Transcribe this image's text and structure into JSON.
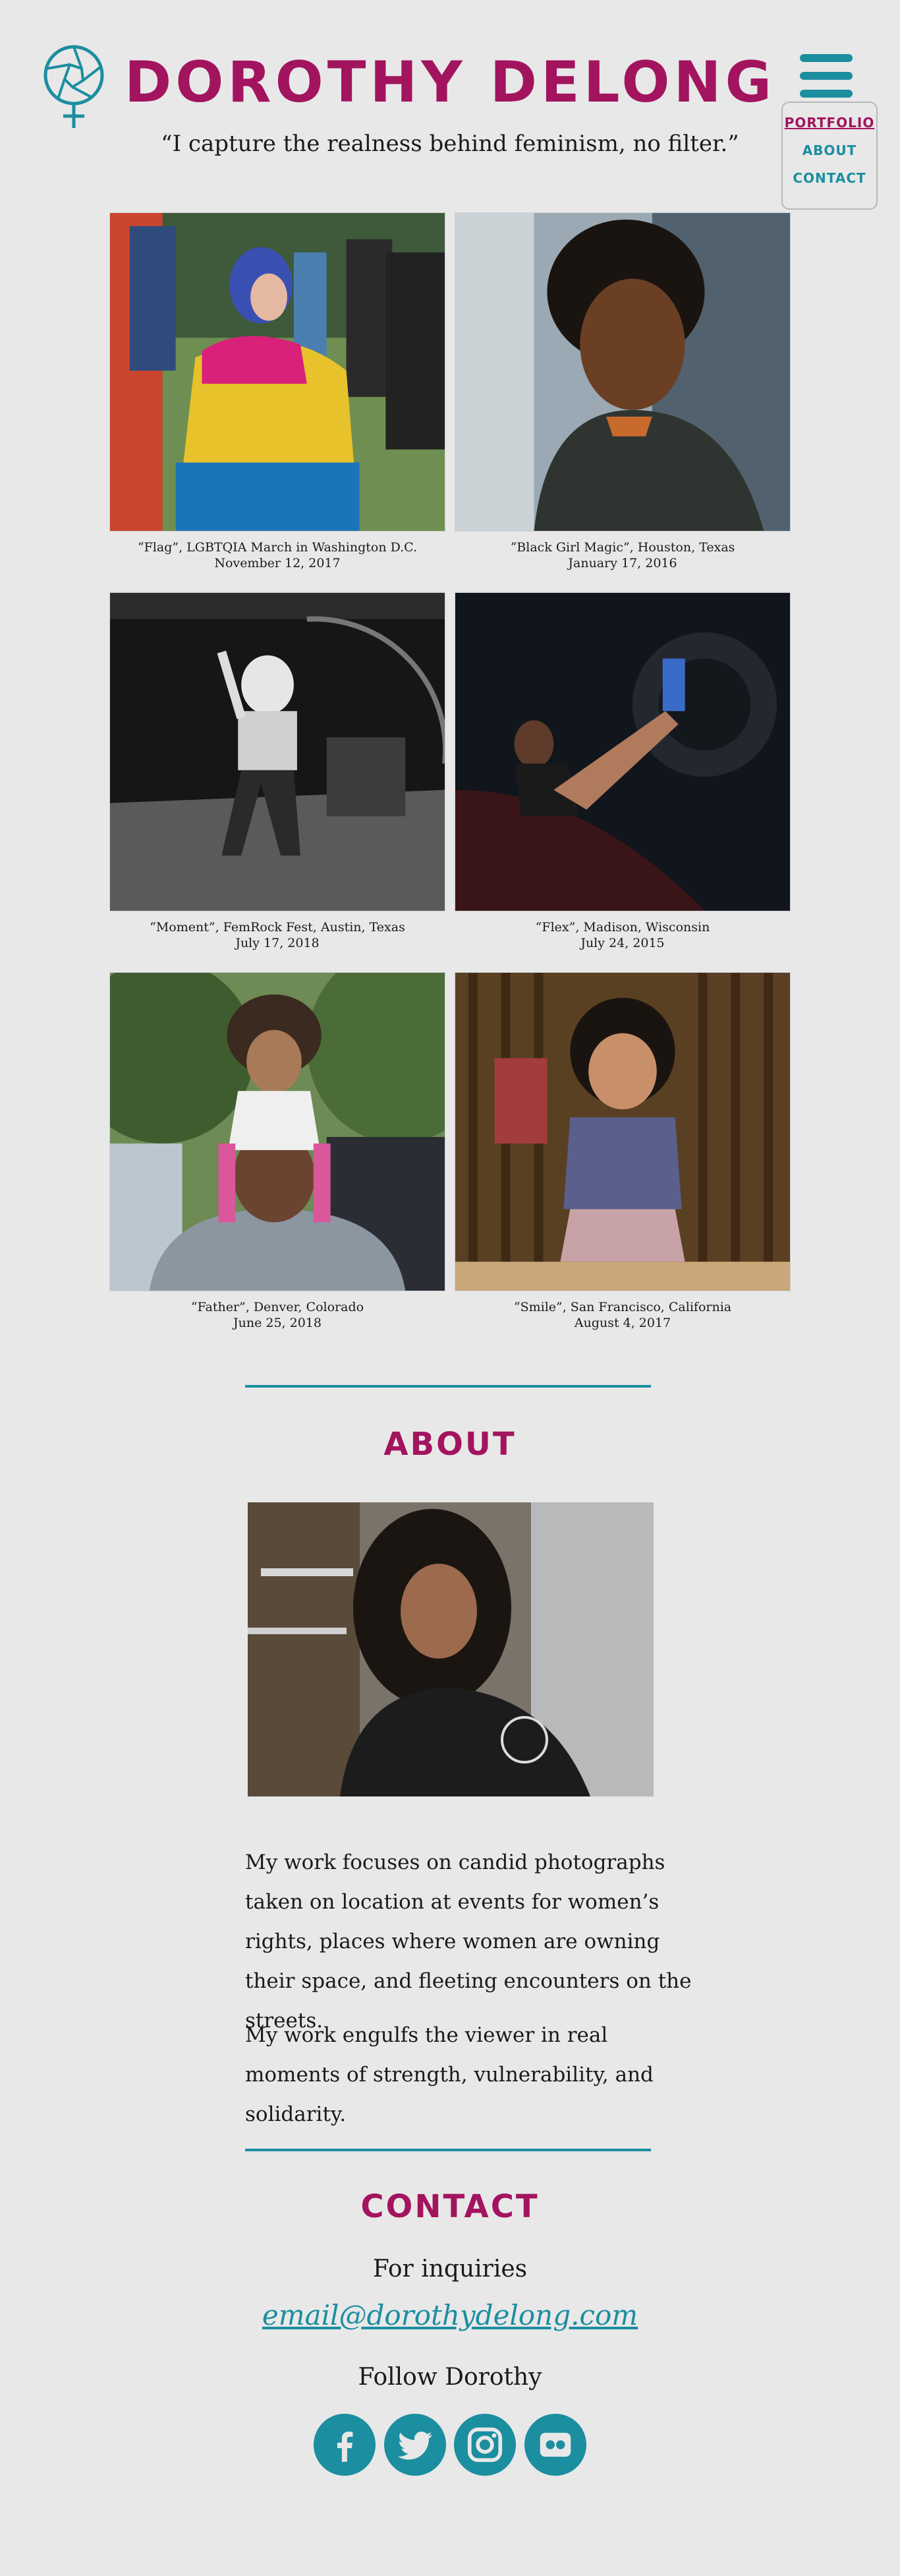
{
  "header": {
    "title": "DOROTHY DELONG",
    "tagline": "“I capture the realness behind feminism, no filter.”",
    "logo_icon": "aperture-venus-icon",
    "menu_icon": "hamburger-icon"
  },
  "nav": {
    "items": [
      {
        "label": "PORTFOLIO",
        "active": true
      },
      {
        "label": "ABOUT",
        "active": false
      },
      {
        "label": "CONTACT",
        "active": false
      }
    ]
  },
  "gallery": [
    {
      "caption": "“Flag”, LGBTQIA March in Washington D.C.",
      "date": "November 12, 2017"
    },
    {
      "caption": "“Black Girl Magic”, Houston, Texas",
      "date": "January 17, 2016"
    },
    {
      "caption": "“Moment”, FemRock Fest, Austin, Texas",
      "date": "July 17, 2018"
    },
    {
      "caption": "“Flex”, Madison, Wisconsin",
      "date": "July 24, 2015"
    },
    {
      "caption": "“Father”, Denver, Colorado",
      "date": "June 25, 2018"
    },
    {
      "caption": "“Smile”, San Francisco, California",
      "date": "August 4, 2017"
    }
  ],
  "about": {
    "heading": "ABOUT",
    "paragraph1": "My work focuses on candid photographs taken on location at events for women’s rights, places where women are owning their space, and fleeting encounters on the streets.",
    "paragraph2": "My work engulfs the viewer in real moments of strength, vulnerability, and solidarity."
  },
  "contact": {
    "heading": "CONTACT",
    "inquiries_label": "For inquiries",
    "email": "email@dorothydelong.com",
    "follow_label": "Follow Dorothy",
    "socials": [
      "facebook-icon",
      "twitter-icon",
      "instagram-icon",
      "flickr-icon"
    ]
  },
  "colors": {
    "accent_magenta": "#a3145f",
    "accent_teal": "#1b8ea0",
    "background": "#e8e8e8"
  }
}
